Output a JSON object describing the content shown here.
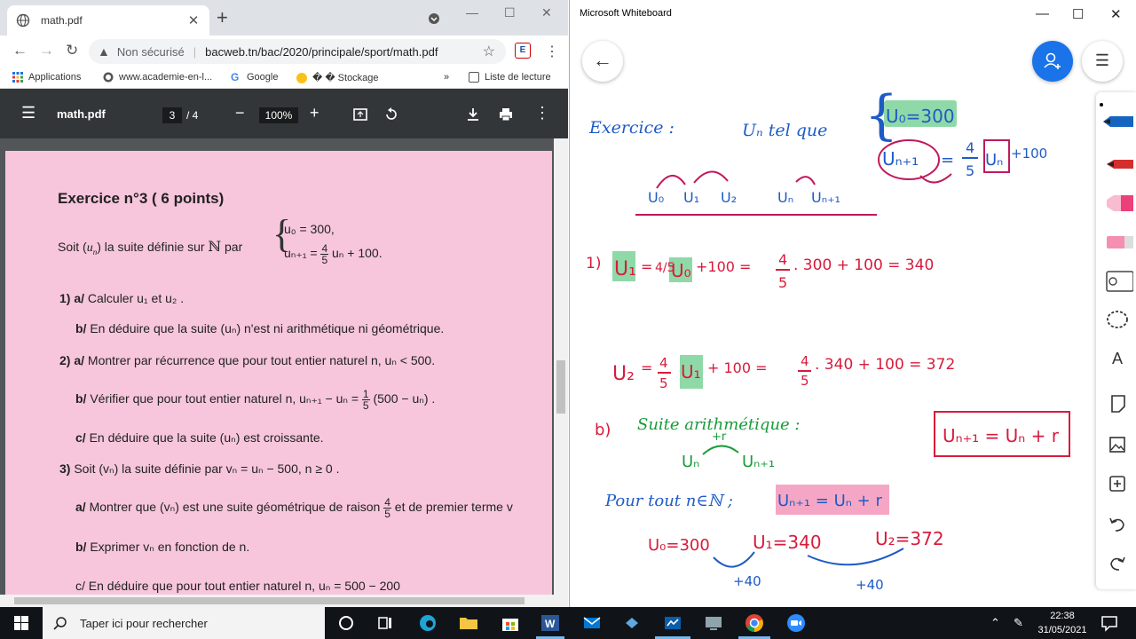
{
  "chrome": {
    "tab_title": "math.pdf",
    "security_label": "Non sécurisé",
    "url": "bacweb.tn/bac/2020/principale/sport/math.pdf",
    "bookmarks": [
      "Applications",
      "www.academie-en-l...",
      "Google",
      "� � Stockage"
    ],
    "bookmarks_more": "»",
    "reading_list": "Liste de lecture"
  },
  "pdf": {
    "filename": "math.pdf",
    "page_current": "3",
    "page_total": "/ 4",
    "zoom": "100%"
  },
  "exercise": {
    "title": "Exercice n°3 ( 6 points)",
    "intro_a": "Soit (",
    "intro_u": "u",
    "intro_n": "n",
    "intro_b": ") la suite définie sur",
    "intro_N": "ℕ",
    "intro_c": "par",
    "def1": "u₀ = 300,",
    "def2_a": "uₙ₊₁ =",
    "def2_num": "4",
    "def2_den": "5",
    "def2_b": "uₙ + 100.",
    "q1a_num": "1) a/",
    "q1a": "Calculer u₁ et u₂ .",
    "q1b_num": "b/",
    "q1b": "En déduire que la suite (uₙ) n'est ni arithmétique ni géométrique.",
    "q2a_num": "2) a/",
    "q2a": "Montrer par récurrence que pour tout entier naturel n, uₙ < 500.",
    "q2b_num": "b/",
    "q2b_a": "Vérifier que pour tout entier naturel n, uₙ₊₁ − uₙ =",
    "q2b_num1": "1",
    "q2b_den1": "5",
    "q2b_b": "(500 − uₙ) .",
    "q2c_num": "c/",
    "q2c": "En déduire que la suite (uₙ) est croissante.",
    "q3_num": "3)",
    "q3": "Soit (vₙ) la suite définie par vₙ = uₙ − 500, n ≥ 0 .",
    "q3a_num": "a/",
    "q3a_a": "Montrer que (vₙ) est une suite géométrique de raison",
    "q3a_fn": "4",
    "q3a_fd": "5",
    "q3a_b": "et de premier terme v",
    "q3b_num": "b/",
    "q3b": "Exprimer vₙ en fonction de n.",
    "q3c": "c/ En déduire que pour tout entier naturel n, uₙ = 500 − 200"
  },
  "whiteboard": {
    "title": "Microsoft Whiteboard",
    "back_icon": "arrow-left",
    "invite_icon": "person-add",
    "menu_icon": "hamburger",
    "ink": {
      "exercice": "Exercice :",
      "un_tel_que": "Uₙ tel que",
      "u0_300": "U₀=300",
      "rec_a": "Uₙ₊₁",
      "rec_b": "=",
      "rec_num": "4",
      "rec_den": "5",
      "rec_c": "Uₙ",
      "rec_d": "+100",
      "axis": [
        "U₀",
        "U₁",
        "U₂",
        "Uₙ",
        "Uₙ₊₁"
      ],
      "q1_label": "1)",
      "q1_line": "U₁ = 4/5 U₀ + 100  =  4/5 . 300 + 100 = 340",
      "q1_u1": "U₁",
      "q1_eq": "=",
      "q1_frac": "4/5",
      "q1_u0": "U₀",
      "q1_rest": "+100  =",
      "q1_frac2n": "4",
      "q1_frac2d": "5",
      "q1_calc": ". 300 + 100 = 340",
      "q2_u2": "U₂",
      "q2_eq": "=",
      "q2_fn": "4",
      "q2_fd": "5",
      "q2_u1": "U₁",
      "q2_rest": "+ 100  =",
      "q2_calc_n": "4",
      "q2_calc_d": "5",
      "q2_calc": ". 340 + 100 = 372",
      "b_label": "b)",
      "suite_arith": "Suite arithmétique :",
      "plus_r": "+r",
      "un_un1_a": "Uₙ",
      "un_un1_b": "Uₙ₊₁",
      "boxed_formula": "Uₙ₊₁ = Uₙ + r",
      "pour_tout": "Pour tout  n∈ℕ ;",
      "highlight_formula": "Uₙ₊₁ = Uₙ + r",
      "seq_u0": "U₀=300",
      "seq_u1": "U₁=340",
      "seq_u2": "U₂=372",
      "plus40_a": "+40",
      "plus40_b": "+40"
    },
    "colors": {
      "blue": "#1e5bc6",
      "red": "#d81b3c",
      "magenta": "#c2185b",
      "green": "#1a9c3a",
      "hl_green": "#8fd9a8",
      "hl_pink": "#f6a6c5"
    }
  },
  "taskbar": {
    "search_placeholder": "Taper ici pour rechercher",
    "time": "22:38",
    "date": "31/05/2021"
  }
}
